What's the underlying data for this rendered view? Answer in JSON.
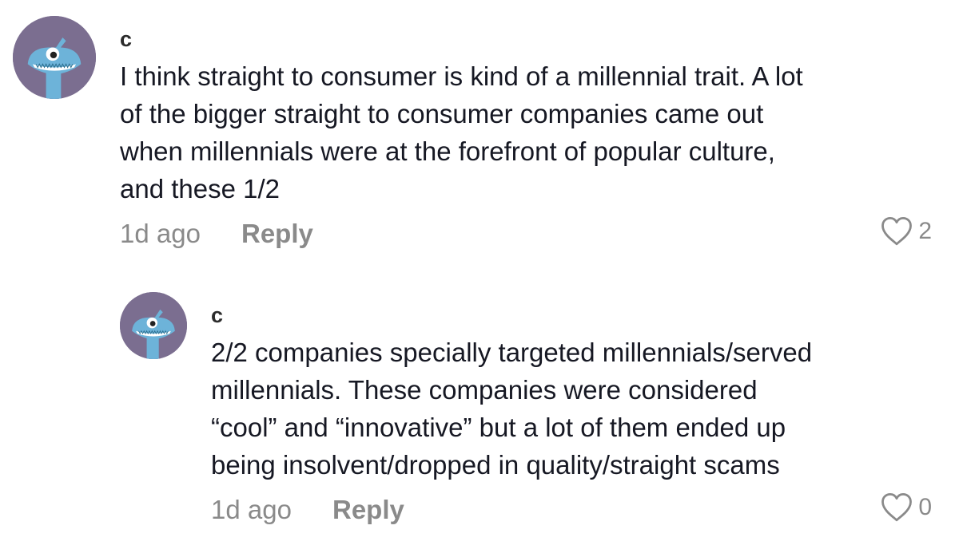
{
  "comments": [
    {
      "username": "c",
      "lines": [
        "I think straight to consumer is kind of a millennial trait. A lot",
        "of the bigger straight to consumer companies came out",
        "when millennials were at the forefront of popular culture,",
        "and these 1/2"
      ],
      "time": "1d ago",
      "reply_label": "Reply",
      "likes": "2",
      "avatar_icon": "monster-avatar-icon"
    },
    {
      "username": "c",
      "lines": [
        "2/2 companies specially targeted millennials/served",
        "millennials. These companies were considered",
        "“cool” and “innovative” but a lot of them ended up",
        "being insolvent/dropped in quality/straight scams"
      ],
      "time": "1d ago",
      "reply_label": "Reply",
      "likes": "0",
      "avatar_icon": "monster-avatar-icon"
    }
  ],
  "colors": {
    "avatar_bg": "#7b6e90",
    "avatar_monster": "#6db3d9",
    "meta_text": "#8a8a8a",
    "body_text": "#161823"
  }
}
